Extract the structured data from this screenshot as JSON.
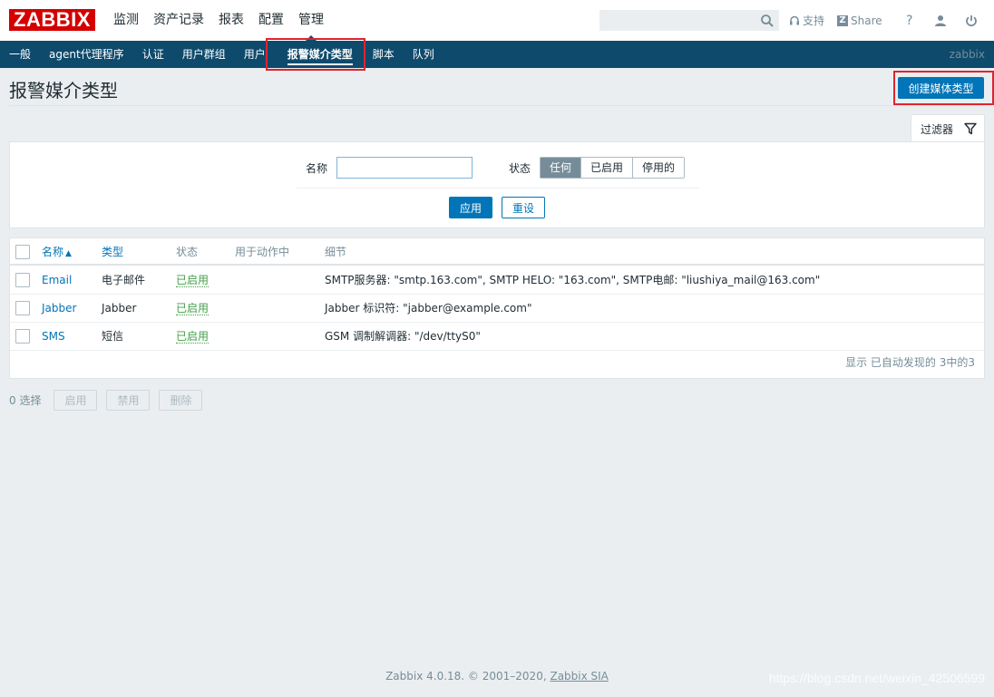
{
  "header": {
    "logo": "ZABBIX",
    "menu": [
      "监测",
      "资产记录",
      "报表",
      "配置",
      "管理"
    ],
    "search_placeholder": "",
    "support_label": "支持",
    "share_label": "Share",
    "help_label": "?"
  },
  "subnav": {
    "items": [
      "一般",
      "agent代理程序",
      "认证",
      "用户群组",
      "用户",
      "报警媒介类型",
      "脚本",
      "队列"
    ],
    "server_name": "zabbix"
  },
  "page": {
    "title": "报警媒介类型",
    "create_button": "创建媒体类型"
  },
  "filter": {
    "tab_label": "过滤器",
    "name_label": "名称",
    "name_value": "",
    "status_label": "状态",
    "status_options": [
      "任何",
      "已启用",
      "停用的"
    ],
    "status_selected": "任何",
    "apply_label": "应用",
    "reset_label": "重设"
  },
  "table": {
    "columns": {
      "name": "名称",
      "sort_arrow": "▲",
      "type": "类型",
      "status": "状态",
      "used_in_actions": "用于动作中",
      "details": "细节"
    },
    "rows": [
      {
        "name": "Email",
        "type": "电子邮件",
        "status": "已启用",
        "used": "",
        "details": "SMTP服务器: \"smtp.163.com\", SMTP HELO: \"163.com\", SMTP电邮: \"liushiya_mail@163.com\""
      },
      {
        "name": "Jabber",
        "type": "Jabber",
        "status": "已启用",
        "used": "",
        "details": "Jabber 标识符: \"jabber@example.com\""
      },
      {
        "name": "SMS",
        "type": "短信",
        "status": "已启用",
        "used": "",
        "details": "GSM 调制解调器: \"/dev/ttyS0\""
      }
    ],
    "summary": "显示 已自动发现的 3中的3"
  },
  "actions": {
    "selected": "0 选择",
    "enable": "启用",
    "disable": "禁用",
    "delete": "删除"
  },
  "footer": {
    "text": "Zabbix 4.0.18. © 2001–2020, ",
    "link": "Zabbix SIA"
  },
  "watermark": "https://blog.csdn.net/weixin_42506599",
  "colors": {
    "brand_red": "#d40000",
    "subnav_bg": "#0e4a6c",
    "primary_blue": "#0275b8",
    "status_green": "#429e47",
    "highlight_red": "#e0242d"
  }
}
